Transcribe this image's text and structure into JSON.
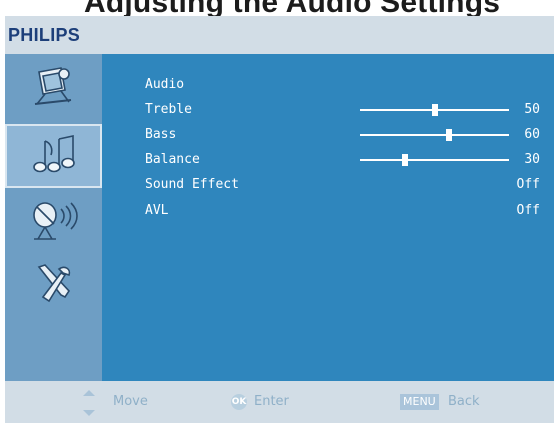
{
  "heading_fragment": "Adjusting the Audio Settings",
  "brand": "PHILIPS",
  "sidebar": {
    "items": [
      {
        "icon": "picture-settings-icon",
        "selected": false
      },
      {
        "icon": "music-notes-icon",
        "selected": true
      },
      {
        "icon": "satellite-dish-icon",
        "selected": false
      },
      {
        "icon": "tools-icon",
        "selected": false
      }
    ]
  },
  "menu": {
    "title": "Audio",
    "items": [
      {
        "label": "Treble",
        "value": "50",
        "level": 50
      },
      {
        "label": "Bass",
        "value": "60",
        "level": 60
      },
      {
        "label": "Balance",
        "value": "30",
        "level": 30
      },
      {
        "label": "Sound Effect",
        "value": "Off"
      },
      {
        "label": "AVL",
        "value": "Off"
      }
    ]
  },
  "footer": {
    "move": "Move",
    "ok_badge": "OK",
    "enter": "Enter",
    "menu_badge": "MENU",
    "back": "Back"
  },
  "colors": {
    "panel": "#2f86bd",
    "sidebar": "#6e9ec4",
    "frame": "#d2dde6",
    "brand": "#1d3f7a"
  }
}
